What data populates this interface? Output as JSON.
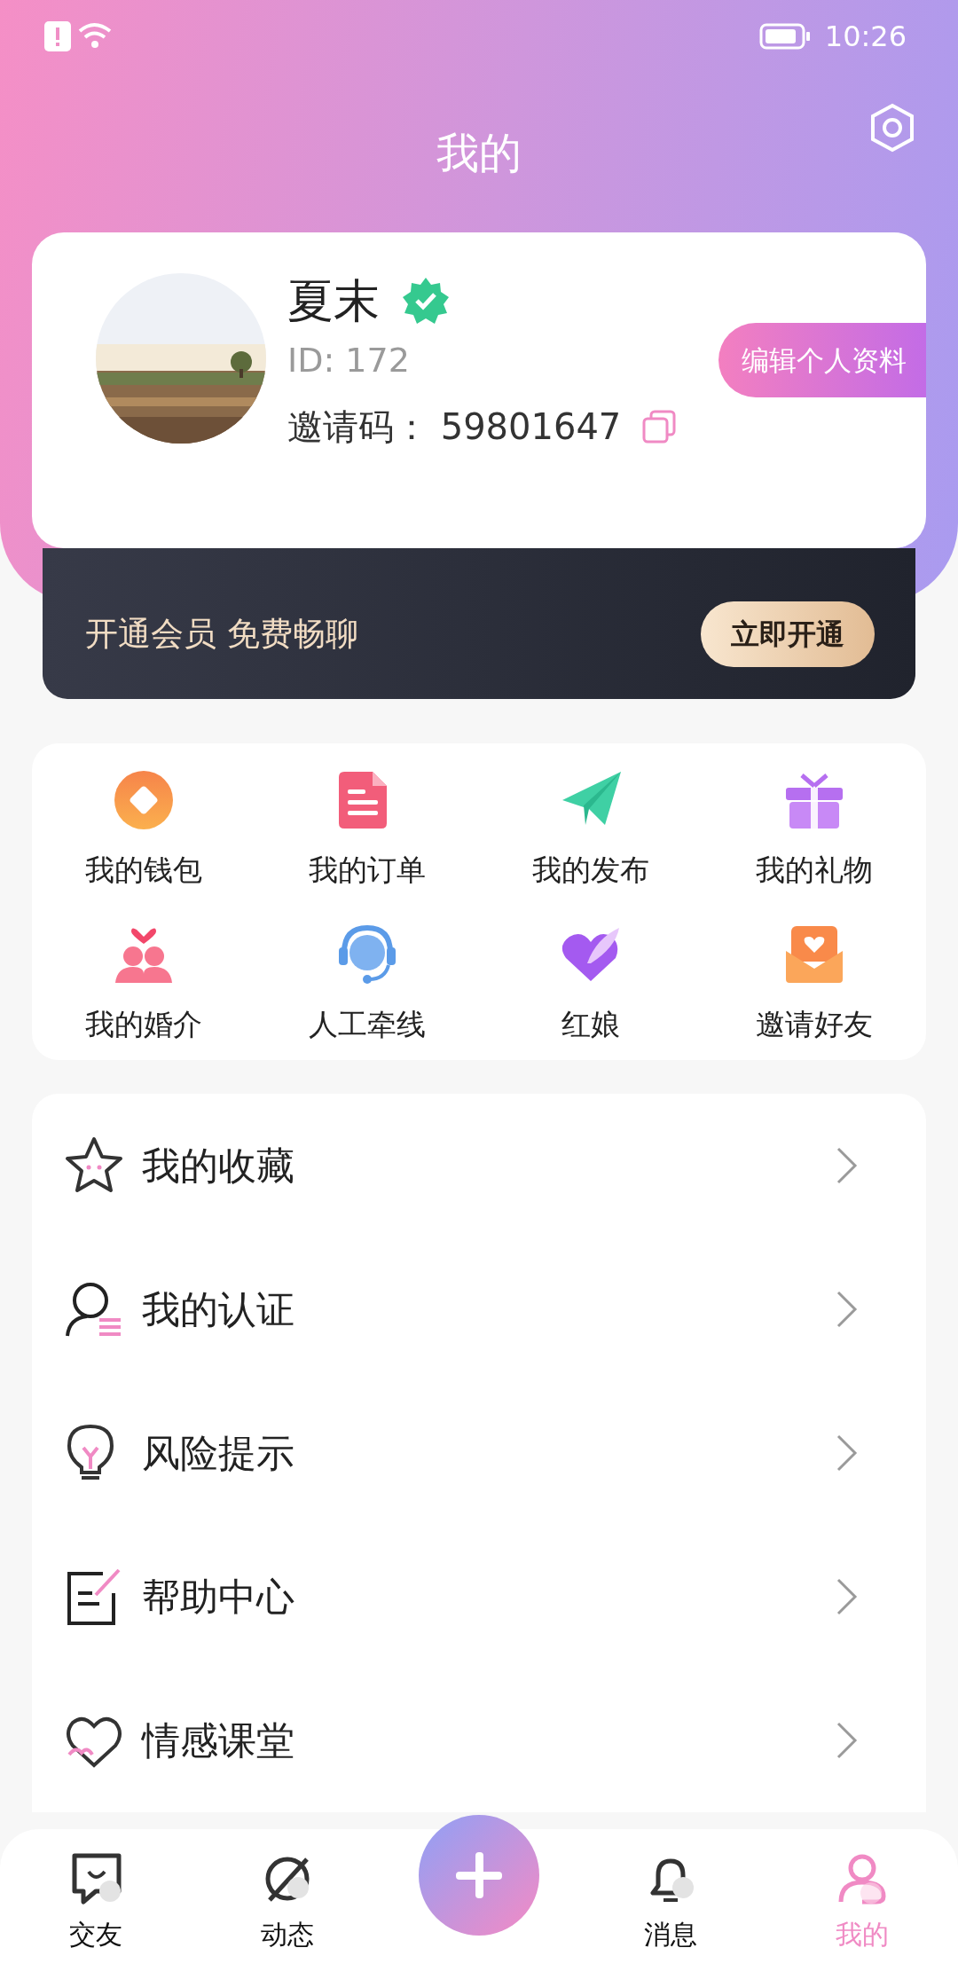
{
  "status_bar": {
    "time": "10:26"
  },
  "title": "我的",
  "profile": {
    "name": "夏末",
    "verified": true,
    "id": "ID: 172",
    "invite_label": "邀请码：",
    "invite_code": "59801647",
    "edit_button": "编辑个人资料"
  },
  "vip_banner": {
    "text": "开通会员 免费畅聊",
    "button": "立即开通"
  },
  "shortcuts": [
    {
      "label": "我的钱包"
    },
    {
      "label": "我的订单"
    },
    {
      "label": "我的发布"
    },
    {
      "label": "我的礼物"
    },
    {
      "label": "我的婚介"
    },
    {
      "label": "人工牵线"
    },
    {
      "label": "红娘"
    },
    {
      "label": "邀请好友"
    }
  ],
  "menu": [
    {
      "label": "我的收藏"
    },
    {
      "label": "我的认证"
    },
    {
      "label": "风险提示"
    },
    {
      "label": "帮助中心"
    },
    {
      "label": "情感课堂"
    }
  ],
  "bottom_nav": [
    {
      "kind": "tab",
      "label": "交友",
      "selected": false
    },
    {
      "kind": "tab",
      "label": "动态",
      "selected": false
    },
    {
      "kind": "add",
      "selected": false
    },
    {
      "kind": "tab",
      "label": "消息",
      "selected": false
    },
    {
      "kind": "tab",
      "label": "我的",
      "selected": true
    }
  ]
}
